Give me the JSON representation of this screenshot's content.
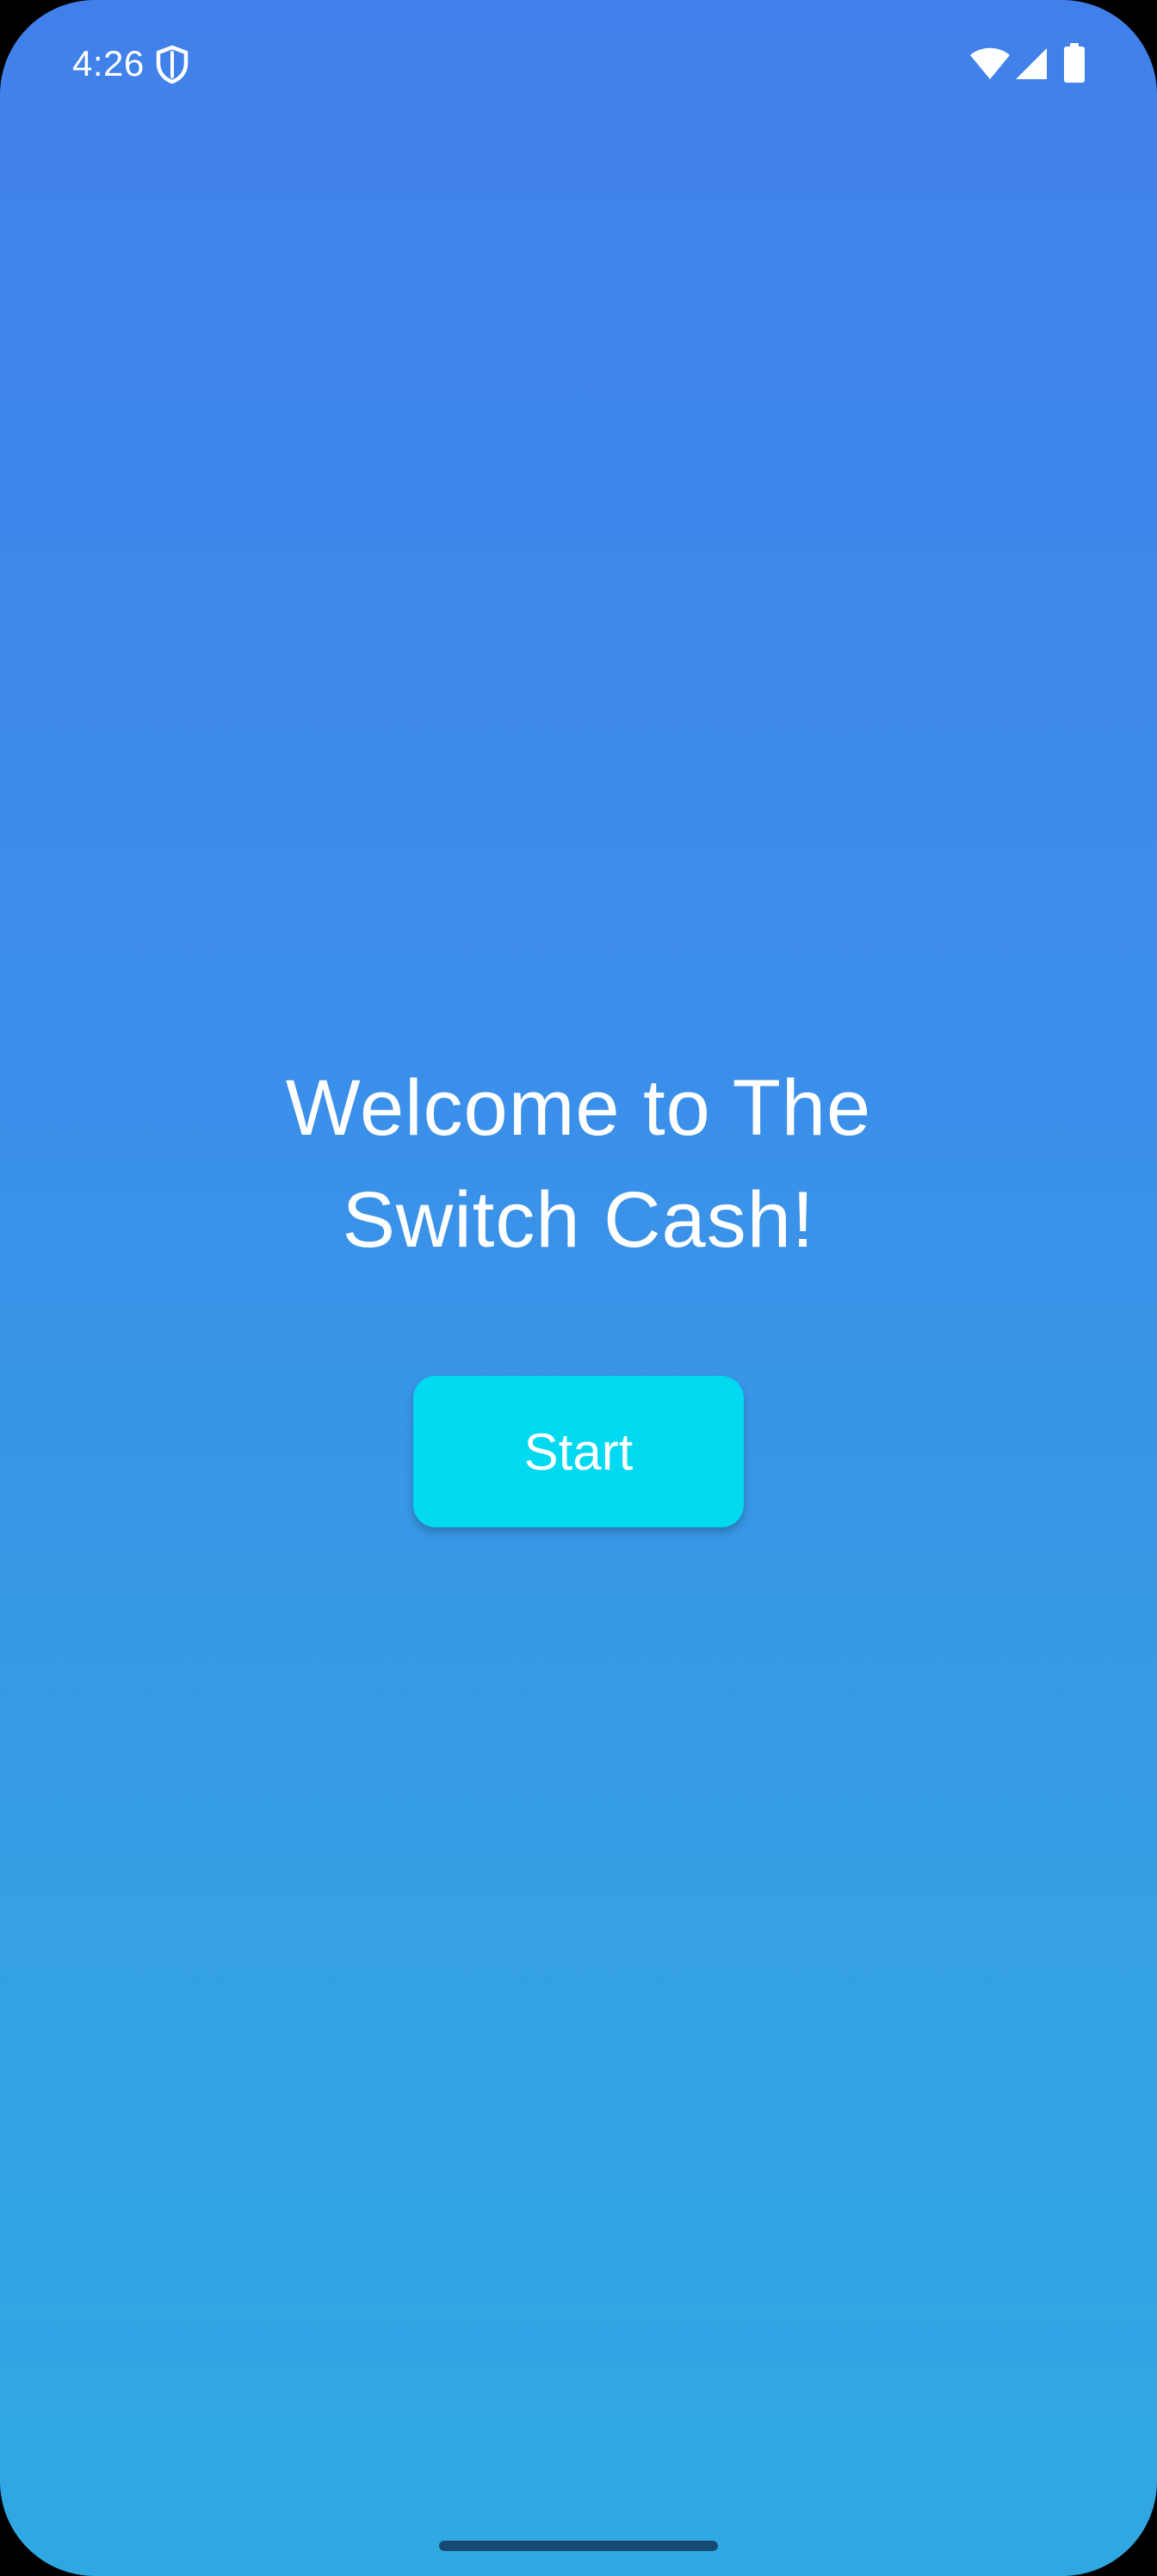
{
  "status_bar": {
    "time": "4:26",
    "icons": [
      "shield-icon",
      "wifi-icon",
      "signal-icon",
      "battery-icon"
    ]
  },
  "welcome": {
    "title_line1": "Welcome to The",
    "title_line2": "Switch Cash!"
  },
  "start_button": {
    "label": "Start"
  },
  "colors": {
    "background_top": "#4180ea",
    "background_bottom": "#2fa8e2",
    "button": "#00d9f0",
    "text": "#ffffff"
  }
}
